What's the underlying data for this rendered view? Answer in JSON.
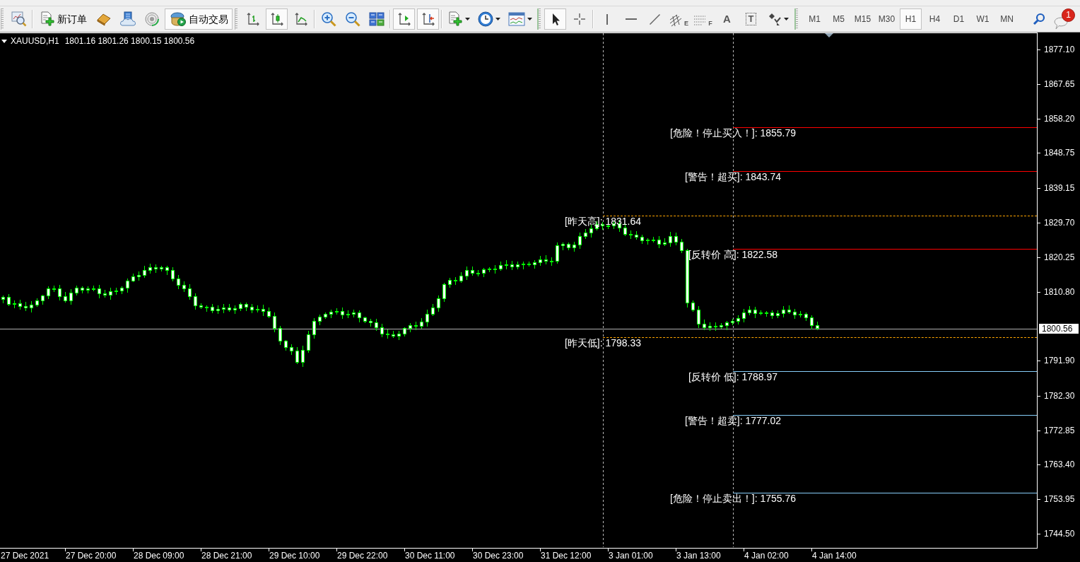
{
  "toolbar": {
    "new_order": {
      "label": "新订单"
    },
    "auto_trading": {
      "label": "自动交易",
      "on": true
    },
    "chart_types": [
      {
        "selected": false
      },
      {
        "selected": true
      },
      {
        "selected": false
      }
    ],
    "chart_shift": {
      "on": true
    },
    "auto_scroll": {
      "on": true
    },
    "cursor_tools": [
      {
        "selected": true
      },
      {
        "selected": false
      }
    ],
    "fibonacci_tools": [
      {
        "letter": "E"
      },
      {
        "letter": "F"
      }
    ],
    "text_tool": {
      "label": "A"
    },
    "text_label_tool": {
      "label": "T"
    },
    "timeframes": [
      {
        "label": "M1",
        "selected": false
      },
      {
        "label": "M5",
        "selected": false
      },
      {
        "label": "M15",
        "selected": false
      },
      {
        "label": "M30",
        "selected": false
      },
      {
        "label": "H1",
        "selected": true
      },
      {
        "label": "H4",
        "selected": false
      },
      {
        "label": "D1",
        "selected": false
      },
      {
        "label": "W1",
        "selected": false
      },
      {
        "label": "MN",
        "selected": false
      }
    ],
    "notifications": {
      "count": "1"
    }
  },
  "chart": {
    "symbol": "XAUUSD,H1",
    "ohlc": "1801.16 1801.26 1800.15 1800.56",
    "levels": [
      {
        "text": "[危险！停止买入！]: 1855.79",
        "color": "#ff0000",
        "kind": "solid"
      },
      {
        "text": "[警告！超买]: 1843.74",
        "color": "#ff0000",
        "kind": "solid"
      },
      {
        "text": "[昨天高]: 1831.64",
        "color": "#ffa500",
        "kind": "dashed"
      },
      {
        "text": "[反转价 高]: 1822.58",
        "color": "#ff0000",
        "kind": "solid"
      },
      {
        "text": "[昨天低]: 1798.33",
        "color": "#ffa500",
        "kind": "dashed"
      },
      {
        "text": "[反转价 低]: 1788.97",
        "color": "#87cefa",
        "kind": "solid"
      },
      {
        "text": "[警告！超卖]: 1777.02",
        "color": "#87cefa",
        "kind": "solid"
      },
      {
        "text": "[危险！停止卖出！]: 1755.76",
        "color": "#87cefa",
        "kind": "solid"
      }
    ],
    "price_axis": {
      "ticks": [
        "1877.10",
        "1867.65",
        "1858.20",
        "1848.75",
        "1839.15",
        "1829.70",
        "1820.25",
        "1810.80",
        "1791.90",
        "1782.30",
        "1772.85",
        "1763.40",
        "1753.95",
        "1744.50"
      ],
      "current_price": "1800.56"
    },
    "time_axis": {
      "labels": [
        "27 Dec 2021",
        "27 Dec 20:00",
        "28 Dec 09:00",
        "28 Dec 21:00",
        "29 Dec 10:00",
        "29 Dec 22:00",
        "30 Dec 11:00",
        "30 Dec 23:00",
        "31 Dec 12:00",
        "3 Jan 01:00",
        "3 Jan 13:00",
        "4 Jan 02:00",
        "4 Jan 14:00"
      ]
    }
  }
}
